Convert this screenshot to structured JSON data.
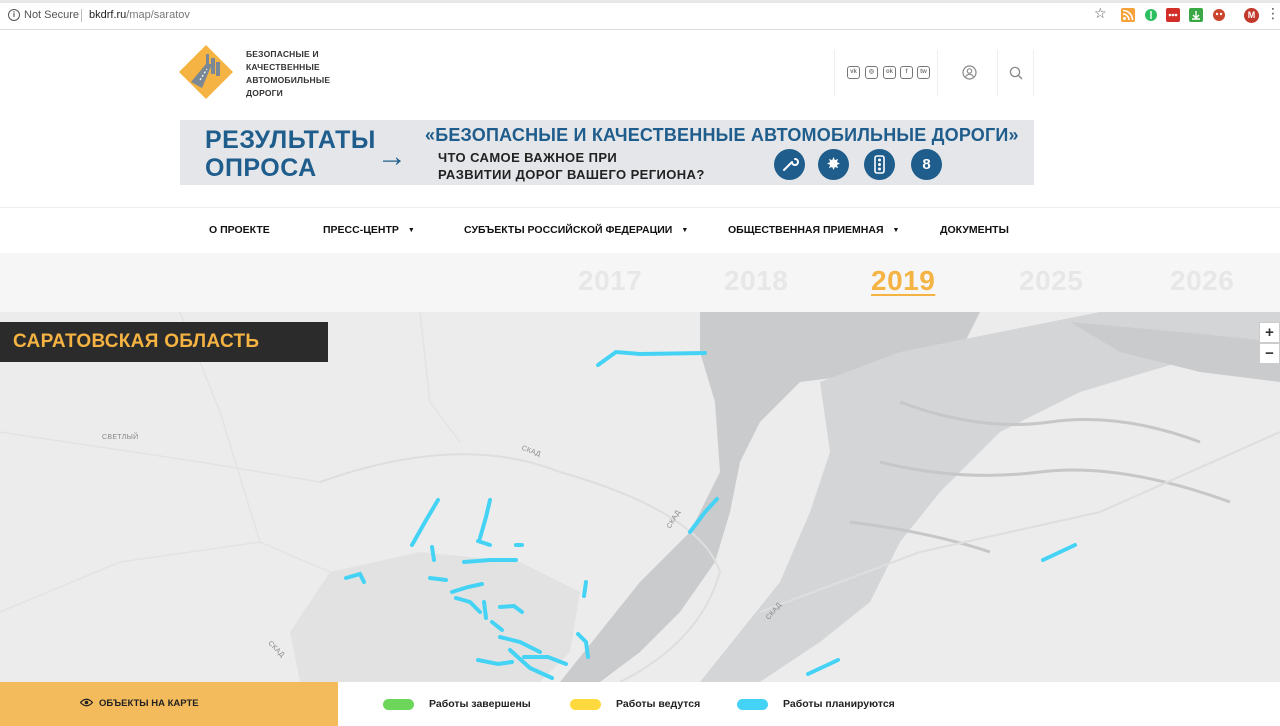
{
  "browser": {
    "security": "Not Secure",
    "url_host": "bkdrf.ru",
    "url_path": "/map/saratov",
    "profile_initial": "M"
  },
  "header": {
    "logo_text": "БЕЗОПАСНЫЕ И КАЧЕСТВЕННЫЕ АВТОМОБИЛЬНЫЕ ДОРОГИ",
    "social": [
      "vk",
      "ig",
      "ok",
      "f",
      "tw"
    ]
  },
  "banner": {
    "left_line1": "РЕЗУЛЬТАТЫ",
    "left_line2": "ОПРОСА",
    "arrow": "→",
    "question_title": "«БЕЗОПАСНЫЕ И КАЧЕСТВЕННЫЕ АВТОМОБИЛЬНЫЕ ДОРОГИ»",
    "sub_line1": "ЧТО САМОЕ ВАЖНОЕ ПРИ",
    "sub_line2": "РАЗВИТИИ ДОРОГ ВАШЕГО РЕГИОНА?",
    "icon4_text": "8"
  },
  "nav": {
    "items": [
      {
        "label": "О ПРОЕКТЕ",
        "dropdown": false
      },
      {
        "label": "ПРЕСС-ЦЕНТР",
        "dropdown": true
      },
      {
        "label": "СУБЪЕКТЫ РОССИЙСКОЙ ФЕДЕРАЦИИ",
        "dropdown": true
      },
      {
        "label": "ОБЩЕСТВЕННАЯ ПРИЕМНАЯ",
        "dropdown": true
      },
      {
        "label": "ДОКУМЕНТЫ",
        "dropdown": false
      }
    ]
  },
  "years": {
    "items": [
      "2017",
      "2018",
      "2019",
      "2025",
      "2026"
    ],
    "active": "2019"
  },
  "map": {
    "region": "САРАТОВСКАЯ ОБЛАСТЬ",
    "zoom_in": "+",
    "zoom_out": "−",
    "labels": {
      "svetly": "СВЕТЛЫЙ",
      "skad1": "СКАД",
      "skad2": "СКАД",
      "skad3": "СКАД",
      "skad4": "СКАД"
    },
    "colors": {
      "land": "#ececec",
      "water": "#c9cbcd",
      "planned": "#45d3f5"
    }
  },
  "legend": {
    "objects_label": "ОБЪЕКТЫ НА КАРТЕ",
    "items": [
      {
        "label": "Работы завершены",
        "color": "#6bd65a"
      },
      {
        "label": "Работы ведутся",
        "color": "#ffd93e"
      },
      {
        "label": "Работы планируются",
        "color": "#45d3f5"
      }
    ]
  }
}
